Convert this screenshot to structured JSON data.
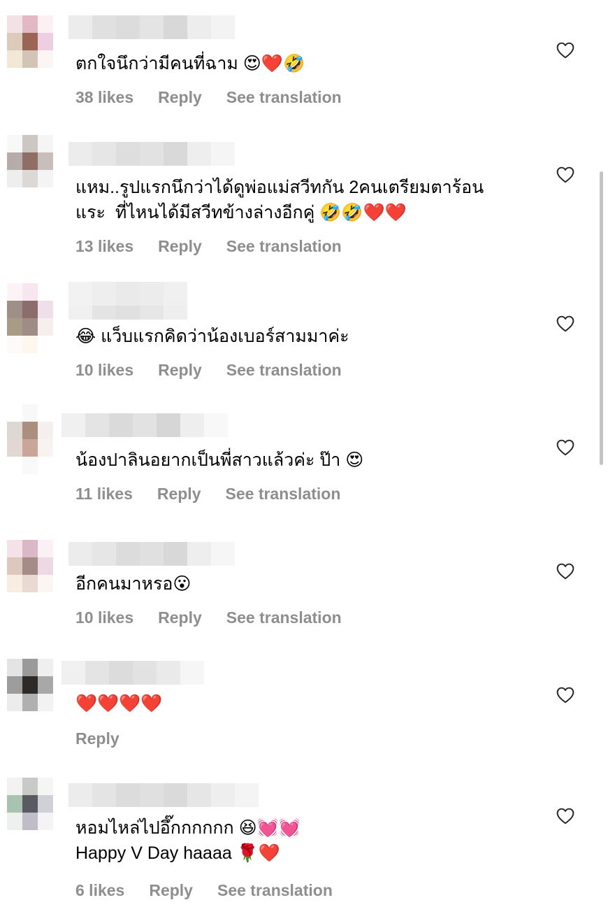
{
  "comments": [
    {
      "text": "ตกใจนึกว่ามีคนที่ฉาม 😍❤️🤣",
      "likes": "38 likes",
      "reply": "Reply",
      "translate": "See translation"
    },
    {
      "text": "แหม..รูปแรกนึกว่าได้ดูพ่อแม่สวีทกัน 2คนเตรียมตาร้อน\nแระ  ที่ไหนได้มีสวีทข้างล่างอีกคู่ 🤣🤣❤️❤️",
      "likes": "13 likes",
      "reply": "Reply",
      "translate": "See translation"
    },
    {
      "text": "😂 แว็บแรกคิดว่าน้องเบอร์สามมาค่ะ",
      "likes": "10 likes",
      "reply": "Reply",
      "translate": "See translation"
    },
    {
      "text": "น้องปาลินอยากเป็นพี่สาวแล้วค่ะ ป๊า 😍",
      "likes": "11 likes",
      "reply": "Reply",
      "translate": "See translation"
    },
    {
      "text": "อีกคนมาหรอ😮",
      "likes": "10 likes",
      "reply": "Reply",
      "translate": "See translation"
    },
    {
      "text": "❤️❤️❤️❤️",
      "likes": "",
      "reply": "Reply",
      "translate": ""
    },
    {
      "text": "หอมไหล่ไปอึ๊กกกกกก 😆💓💓\nHappy V Day haaaa 🌹❤️",
      "likes": "6 likes",
      "reply": "Reply",
      "translate": "See translation"
    }
  ],
  "icons": {
    "like": "heart-outline-icon"
  },
  "colors": {
    "meta_text": "#8e8e8e",
    "icon_stroke": "#262626",
    "scrollbar": "#c4c4c4"
  }
}
